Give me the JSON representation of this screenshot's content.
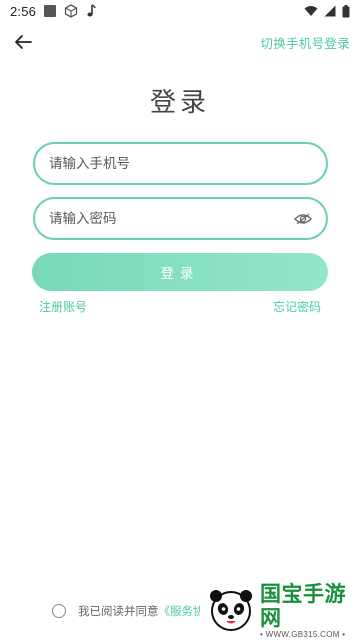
{
  "status_bar": {
    "time": "2:56"
  },
  "header": {
    "switch_label": "切换手机号登录"
  },
  "title": "登录",
  "form": {
    "phone_placeholder": "请输入手机号",
    "password_placeholder": "请输入密码",
    "login_label": "登录",
    "register_label": "注册账号",
    "forgot_label": "忘记密码"
  },
  "agreement": {
    "text": "我已阅读并同意",
    "link": "《服务协"
  },
  "watermark": {
    "title": "国宝手游网",
    "url": "• WWW.GB315.COM •"
  },
  "colors": {
    "accent": "#4cc9a0",
    "border": "#6ad1b0",
    "button_start": "#79d8b9",
    "button_end": "#93e6c9",
    "text": "#444444"
  }
}
